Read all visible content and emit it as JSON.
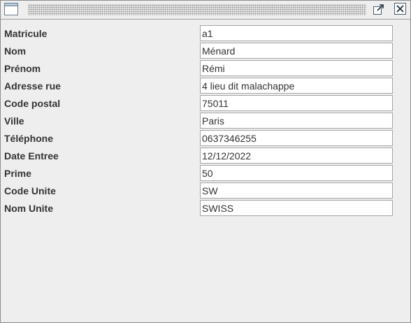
{
  "titlebar": {
    "system_icon": "window-icon",
    "maximize_icon": "maximize-icon",
    "close_icon": "close-icon"
  },
  "form": {
    "fields": [
      {
        "label": "Matricule",
        "value": "a1"
      },
      {
        "label": "Nom",
        "value": "Ménard"
      },
      {
        "label": "Prénom",
        "value": "Rémi"
      },
      {
        "label": "Adresse rue",
        "value": "4 lieu dit malachappe"
      },
      {
        "label": "Code postal",
        "value": "75011"
      },
      {
        "label": "Ville",
        "value": "Paris"
      },
      {
        "label": "Téléphone",
        "value": "0637346255"
      },
      {
        "label": "Date Entree",
        "value": "12/12/2022"
      },
      {
        "label": "Prime",
        "value": "50"
      },
      {
        "label": "Code Unite",
        "value": "SW"
      },
      {
        "label": "Nom Unite",
        "value": "SWISS"
      }
    ]
  }
}
